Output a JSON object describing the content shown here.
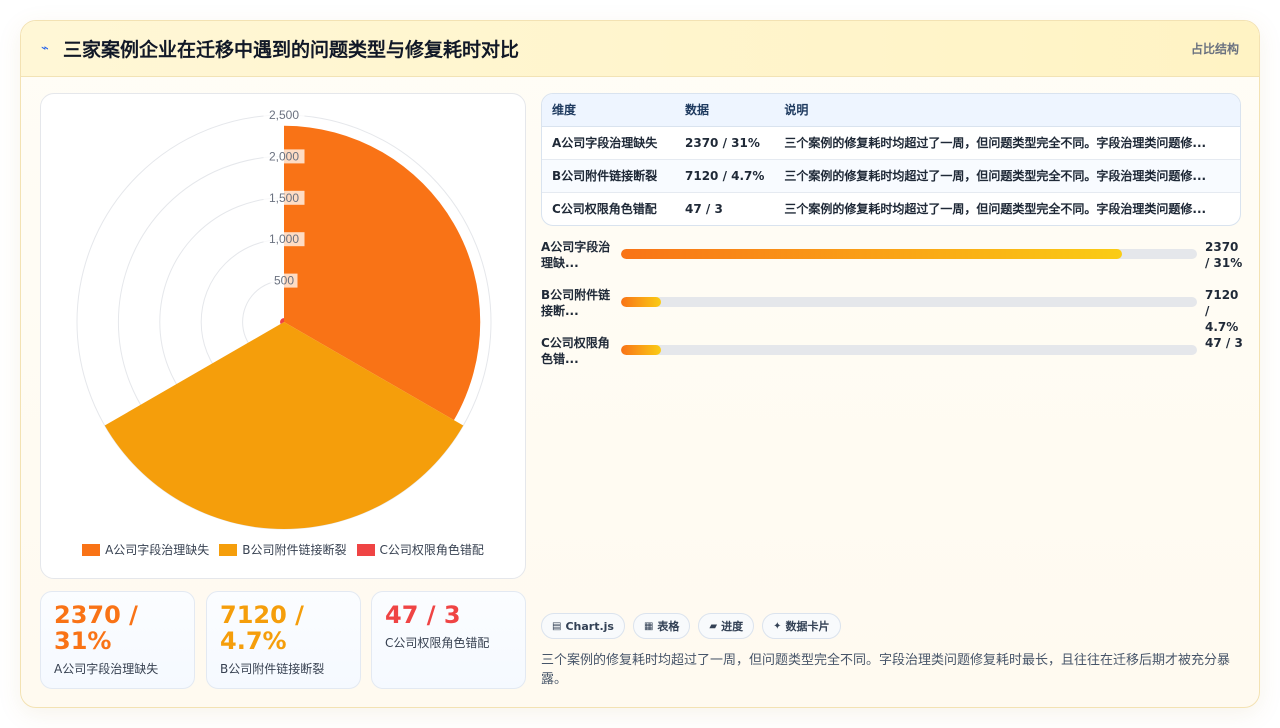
{
  "header": {
    "title": "三家案例企业在迁移中遇到的问题类型与修复耗时对比",
    "tag": "占比结构"
  },
  "colors": {
    "series_a": "#f97316",
    "series_b": "#f59e0b",
    "series_c": "#ef4444"
  },
  "chart_data": {
    "type": "polarArea",
    "categories": [
      "A公司字段治理缺失",
      "B公司附件链接断裂",
      "C公司权限角色错配"
    ],
    "values": [
      2370,
      7120,
      47
    ],
    "r_max": 2500,
    "r_ticks": [
      "500",
      "1,000",
      "1,500",
      "2,000",
      "2,500"
    ],
    "legend_position": "bottom"
  },
  "stats": [
    {
      "value": "2370 / 31%",
      "label": "A公司字段治理缺失",
      "color": "#f97316"
    },
    {
      "value": "7120 / 4.7%",
      "label": "B公司附件链接断裂",
      "color": "#f59e0b"
    },
    {
      "value": "47 / 3",
      "label": "C公司权限角色错配",
      "color": "#ef4444"
    }
  ],
  "table": {
    "headers": [
      "维度",
      "数据",
      "说明"
    ],
    "rows": [
      [
        "A公司字段治理缺失",
        "2370 / 31%",
        "三个案例的修复耗时均超过了一周，但问题类型完全不同。字段治理类问题修..."
      ],
      [
        "B公司附件链接断裂",
        "7120 / 4.7%",
        "三个案例的修复耗时均超过了一周，但问题类型完全不同。字段治理类问题修..."
      ],
      [
        "C公司权限角色错配",
        "47 / 3",
        "三个案例的修复耗时均超过了一周，但问题类型完全不同。字段治理类问题修..."
      ]
    ]
  },
  "progress": [
    {
      "label": "A公司字段治理缺...",
      "value": "2370 / 31%",
      "fraction": 0.87
    },
    {
      "label": "B公司附件链接断...",
      "value": "7120 / 4.7%",
      "fraction": 0.07
    },
    {
      "label": "C公司权限角色错...",
      "value": "47 / 3",
      "fraction": 0.07
    }
  ],
  "chips": [
    {
      "icon": "chart-icon",
      "label": "Chart.js"
    },
    {
      "icon": "table-icon",
      "label": "表格"
    },
    {
      "icon": "progress-icon",
      "label": "进度"
    },
    {
      "icon": "sparkle-icon",
      "label": "数据卡片"
    }
  ],
  "footnote": "三个案例的修复耗时均超过了一周，但问题类型完全不同。字段治理类问题修复耗时最长，且往往在迁移后期才被充分暴露。"
}
